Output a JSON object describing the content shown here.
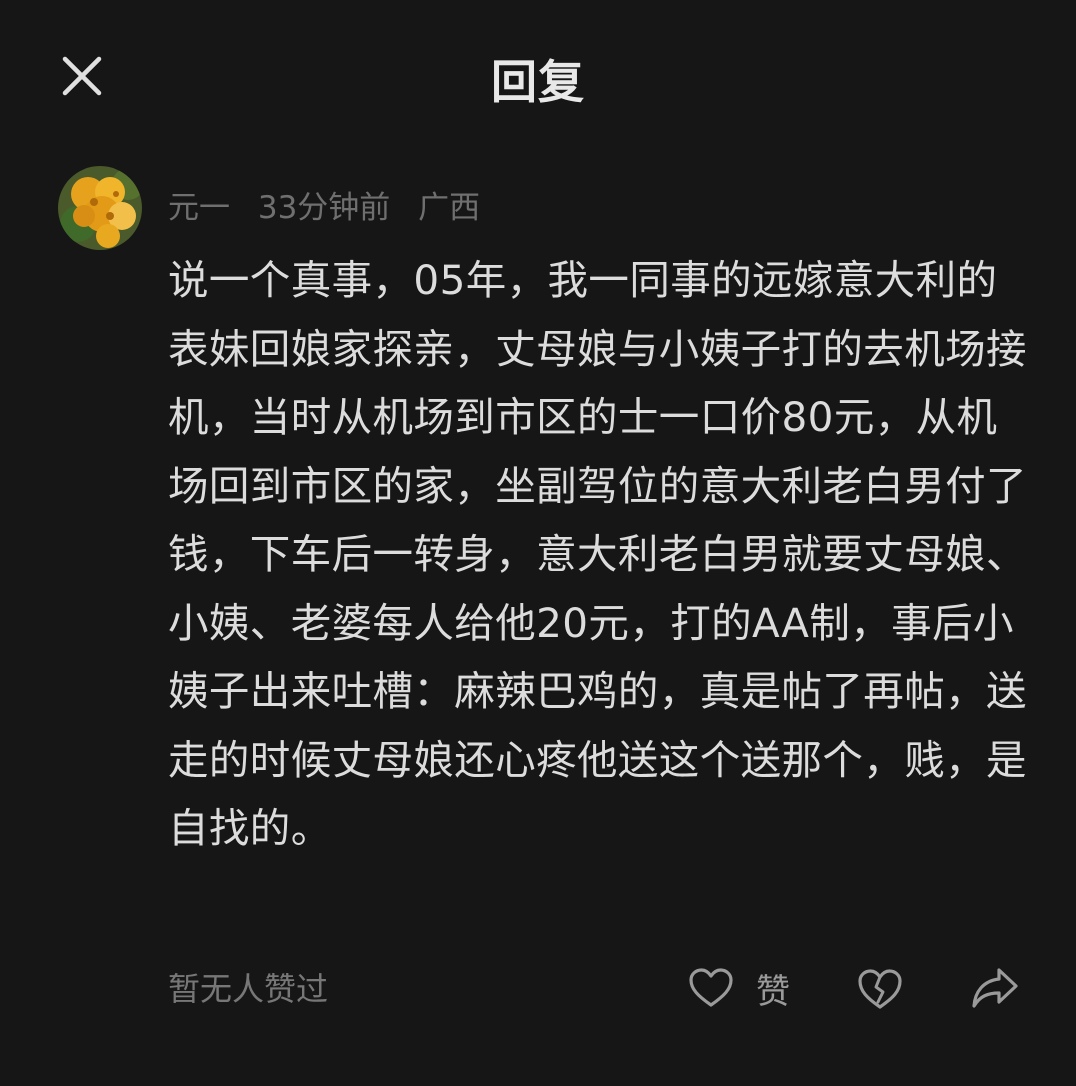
{
  "header": {
    "title": "回复",
    "close_icon": "close-icon"
  },
  "comment": {
    "author": "元一",
    "time": "33分钟前",
    "location": "广西",
    "avatar_icon": "flower-avatar",
    "body": "说一个真事，05年，我一同事的远嫁意大利的表妹回娘家探亲，丈母娘与小姨子打的去机场接机，当时从机场到市区的士一口价80元，从机场回到市区的家，坐副驾位的意大利老白男付了钱，下车后一转身，意大利老白男就要丈母娘、小姨、老婆每人给他20元，打的AA制，事后小姨子出来吐槽：麻辣巴鸡的，真是帖了再帖，送走的时候丈母娘还心疼他送这个送那个，贱，是自找的。"
  },
  "footer": {
    "likes_status": "暂无人赞过",
    "like_label": "赞",
    "like_icon": "heart-icon",
    "dislike_icon": "broken-heart-icon",
    "share_icon": "share-arrow-icon"
  },
  "colors": {
    "background": "#161616",
    "text_primary": "#dcdcdc",
    "text_secondary": "#6f6f6f"
  }
}
